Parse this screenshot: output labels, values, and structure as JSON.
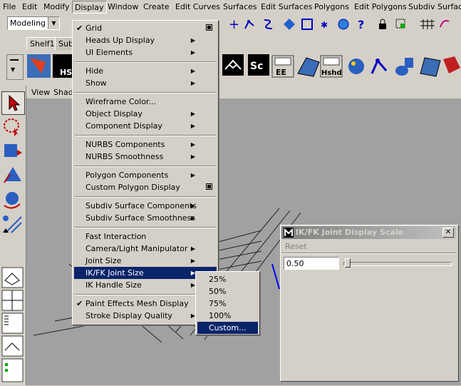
{
  "menubar": {
    "items": [
      "File",
      "Edit",
      "Modify",
      "Display",
      "Window",
      "Create",
      "Edit Curves",
      "Surfaces",
      "Edit Surfaces",
      "Polygons",
      "Edit Polygons",
      "Subdiv Surfaces"
    ]
  },
  "status_line": {
    "mode": "Modeling"
  },
  "shelf": {
    "tabs": [
      "Shelf1",
      "Sub"
    ],
    "icon_labels": [
      "HS",
      "Sc",
      "EE",
      "Hshd"
    ]
  },
  "viewport": {
    "menu": [
      "View",
      "Shad"
    ]
  },
  "display_menu": {
    "items": [
      {
        "label": "Grid",
        "checked": true,
        "option_box": true
      },
      {
        "label": "Heads Up Display",
        "submenu": true
      },
      {
        "label": "UI Elements",
        "submenu": true
      },
      {
        "label": "Hide",
        "submenu": true
      },
      {
        "label": "Show",
        "submenu": true
      },
      {
        "label": "Wireframe Color..."
      },
      {
        "label": "Object Display",
        "submenu": true
      },
      {
        "label": "Component Display",
        "submenu": true
      },
      {
        "label": "NURBS Components",
        "submenu": true
      },
      {
        "label": "NURBS Smoothness",
        "submenu": true
      },
      {
        "label": "Polygon Components",
        "submenu": true
      },
      {
        "label": "Custom Polygon Display",
        "option_box": true
      },
      {
        "label": "Subdiv Surface Components",
        "submenu": true
      },
      {
        "label": "Subdiv Surface Smoothness",
        "submenu": true
      },
      {
        "label": "Fast Interaction"
      },
      {
        "label": "Camera/Light Manipulator",
        "submenu": true
      },
      {
        "label": "Joint Size",
        "submenu": true
      },
      {
        "label": "IK/FK Joint Size",
        "submenu": true,
        "highlighted": true
      },
      {
        "label": "IK Handle Size",
        "submenu": true
      },
      {
        "label": "Paint Effects Mesh Display",
        "checked": true
      },
      {
        "label": "Stroke Display Quality",
        "submenu": true
      }
    ]
  },
  "joint_size_submenu": {
    "items": [
      "25%",
      "50%",
      "75%",
      "100%",
      "Custom..."
    ],
    "highlighted": "Custom..."
  },
  "dialog": {
    "title": "IK/FK Joint Display Scale",
    "reset_label": "Reset",
    "value": "0.50",
    "close_glyph": "✕"
  },
  "colors": {
    "menu_bg": "#d4d0c8",
    "highlight": "#0a246a",
    "viewport_bg": "#a1a1a1",
    "grid_line": "#000000"
  }
}
